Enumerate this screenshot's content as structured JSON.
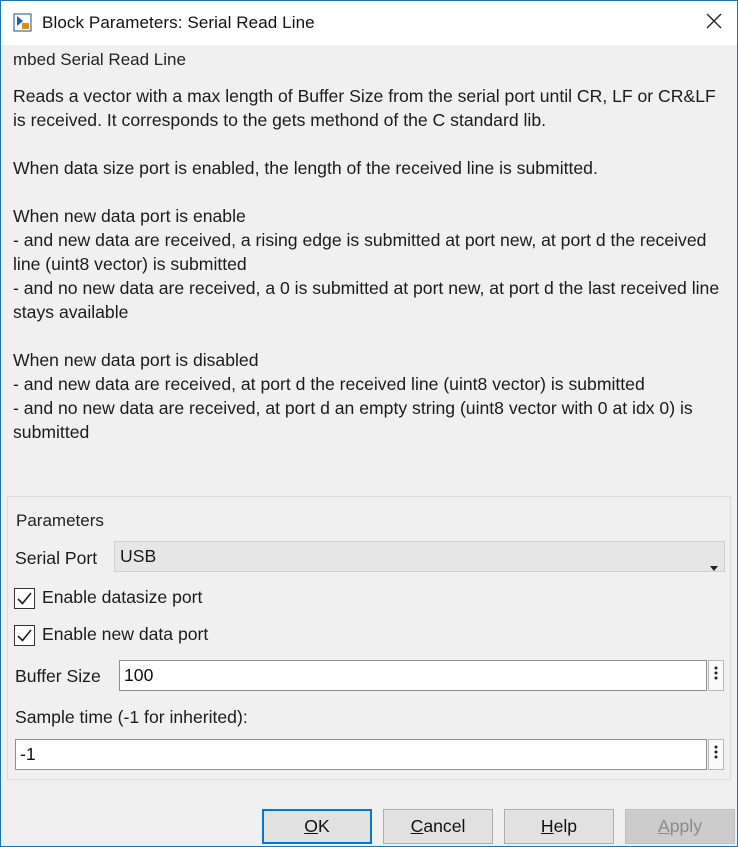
{
  "window": {
    "title": "Block Parameters: Serial Read Line",
    "icon": "simulink-block-icon",
    "close_icon": "close-icon"
  },
  "description": {
    "group_title": "mbed Serial Read Line",
    "text": "Reads a vector with a max length of Buffer Size from the serial port until CR, LF or CR&LF is received. It corresponds to the gets methond of the C standard lib.\n\nWhen data size port is enabled, the length of the received line is submitted.\n\nWhen new data port is enable\n- and new data are received, a rising edge is submitted at port new, at port d the received line (uint8 vector) is submitted\n- and no new data are received, a 0 is submitted at port new, at port d the last received line stays available\n\nWhen new data port is disabled\n- and new data are received, at port d the received line (uint8 vector) is submitted\n- and no new data are received, at port d an empty string (uint8 vector with 0 at idx 0) is submitted"
  },
  "parameters": {
    "group_title": "Parameters",
    "serial_port": {
      "label": "Serial Port",
      "value": "USB"
    },
    "enable_datasize": {
      "label": "Enable datasize port",
      "checked": true
    },
    "enable_new_data": {
      "label": "Enable new data port",
      "checked": true
    },
    "buffer_size": {
      "label": "Buffer Size",
      "value": "100"
    },
    "sample_time": {
      "label": "Sample time (-1 for inherited):",
      "value": "-1"
    }
  },
  "buttons": {
    "ok": {
      "mnemonic": "O",
      "rest": "K"
    },
    "cancel": {
      "mnemonic": "C",
      "rest": "ancel"
    },
    "help": {
      "mnemonic": "H",
      "rest": "elp"
    },
    "apply": {
      "mnemonic": "A",
      "rest": "pply",
      "enabled": false
    }
  },
  "colors": {
    "accent": "#0078d7",
    "window_border": "#1a73b8",
    "background": "#f0f0f0"
  }
}
